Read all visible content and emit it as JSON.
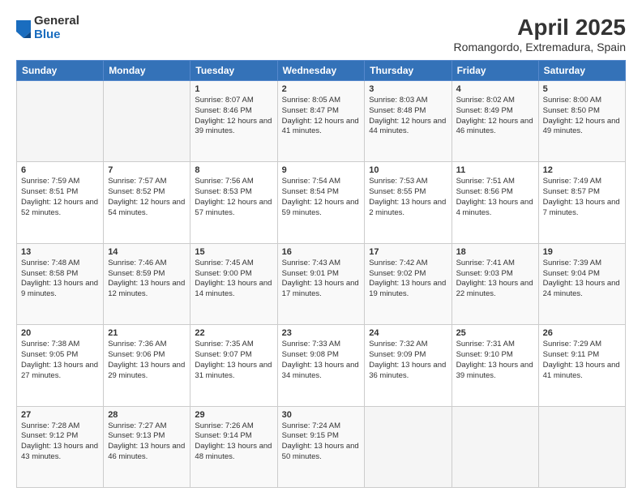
{
  "header": {
    "title": "April 2025",
    "subtitle": "Romangordo, Extremadura, Spain",
    "logo_general": "General",
    "logo_blue": "Blue"
  },
  "weekdays": [
    "Sunday",
    "Monday",
    "Tuesday",
    "Wednesday",
    "Thursday",
    "Friday",
    "Saturday"
  ],
  "weeks": [
    [
      {
        "day": "",
        "sunrise": "",
        "sunset": "",
        "daylight": ""
      },
      {
        "day": "",
        "sunrise": "",
        "sunset": "",
        "daylight": ""
      },
      {
        "day": "1",
        "sunrise": "Sunrise: 8:07 AM",
        "sunset": "Sunset: 8:46 PM",
        "daylight": "Daylight: 12 hours and 39 minutes."
      },
      {
        "day": "2",
        "sunrise": "Sunrise: 8:05 AM",
        "sunset": "Sunset: 8:47 PM",
        "daylight": "Daylight: 12 hours and 41 minutes."
      },
      {
        "day": "3",
        "sunrise": "Sunrise: 8:03 AM",
        "sunset": "Sunset: 8:48 PM",
        "daylight": "Daylight: 12 hours and 44 minutes."
      },
      {
        "day": "4",
        "sunrise": "Sunrise: 8:02 AM",
        "sunset": "Sunset: 8:49 PM",
        "daylight": "Daylight: 12 hours and 46 minutes."
      },
      {
        "day": "5",
        "sunrise": "Sunrise: 8:00 AM",
        "sunset": "Sunset: 8:50 PM",
        "daylight": "Daylight: 12 hours and 49 minutes."
      }
    ],
    [
      {
        "day": "6",
        "sunrise": "Sunrise: 7:59 AM",
        "sunset": "Sunset: 8:51 PM",
        "daylight": "Daylight: 12 hours and 52 minutes."
      },
      {
        "day": "7",
        "sunrise": "Sunrise: 7:57 AM",
        "sunset": "Sunset: 8:52 PM",
        "daylight": "Daylight: 12 hours and 54 minutes."
      },
      {
        "day": "8",
        "sunrise": "Sunrise: 7:56 AM",
        "sunset": "Sunset: 8:53 PM",
        "daylight": "Daylight: 12 hours and 57 minutes."
      },
      {
        "day": "9",
        "sunrise": "Sunrise: 7:54 AM",
        "sunset": "Sunset: 8:54 PM",
        "daylight": "Daylight: 12 hours and 59 minutes."
      },
      {
        "day": "10",
        "sunrise": "Sunrise: 7:53 AM",
        "sunset": "Sunset: 8:55 PM",
        "daylight": "Daylight: 13 hours and 2 minutes."
      },
      {
        "day": "11",
        "sunrise": "Sunrise: 7:51 AM",
        "sunset": "Sunset: 8:56 PM",
        "daylight": "Daylight: 13 hours and 4 minutes."
      },
      {
        "day": "12",
        "sunrise": "Sunrise: 7:49 AM",
        "sunset": "Sunset: 8:57 PM",
        "daylight": "Daylight: 13 hours and 7 minutes."
      }
    ],
    [
      {
        "day": "13",
        "sunrise": "Sunrise: 7:48 AM",
        "sunset": "Sunset: 8:58 PM",
        "daylight": "Daylight: 13 hours and 9 minutes."
      },
      {
        "day": "14",
        "sunrise": "Sunrise: 7:46 AM",
        "sunset": "Sunset: 8:59 PM",
        "daylight": "Daylight: 13 hours and 12 minutes."
      },
      {
        "day": "15",
        "sunrise": "Sunrise: 7:45 AM",
        "sunset": "Sunset: 9:00 PM",
        "daylight": "Daylight: 13 hours and 14 minutes."
      },
      {
        "day": "16",
        "sunrise": "Sunrise: 7:43 AM",
        "sunset": "Sunset: 9:01 PM",
        "daylight": "Daylight: 13 hours and 17 minutes."
      },
      {
        "day": "17",
        "sunrise": "Sunrise: 7:42 AM",
        "sunset": "Sunset: 9:02 PM",
        "daylight": "Daylight: 13 hours and 19 minutes."
      },
      {
        "day": "18",
        "sunrise": "Sunrise: 7:41 AM",
        "sunset": "Sunset: 9:03 PM",
        "daylight": "Daylight: 13 hours and 22 minutes."
      },
      {
        "day": "19",
        "sunrise": "Sunrise: 7:39 AM",
        "sunset": "Sunset: 9:04 PM",
        "daylight": "Daylight: 13 hours and 24 minutes."
      }
    ],
    [
      {
        "day": "20",
        "sunrise": "Sunrise: 7:38 AM",
        "sunset": "Sunset: 9:05 PM",
        "daylight": "Daylight: 13 hours and 27 minutes."
      },
      {
        "day": "21",
        "sunrise": "Sunrise: 7:36 AM",
        "sunset": "Sunset: 9:06 PM",
        "daylight": "Daylight: 13 hours and 29 minutes."
      },
      {
        "day": "22",
        "sunrise": "Sunrise: 7:35 AM",
        "sunset": "Sunset: 9:07 PM",
        "daylight": "Daylight: 13 hours and 31 minutes."
      },
      {
        "day": "23",
        "sunrise": "Sunrise: 7:33 AM",
        "sunset": "Sunset: 9:08 PM",
        "daylight": "Daylight: 13 hours and 34 minutes."
      },
      {
        "day": "24",
        "sunrise": "Sunrise: 7:32 AM",
        "sunset": "Sunset: 9:09 PM",
        "daylight": "Daylight: 13 hours and 36 minutes."
      },
      {
        "day": "25",
        "sunrise": "Sunrise: 7:31 AM",
        "sunset": "Sunset: 9:10 PM",
        "daylight": "Daylight: 13 hours and 39 minutes."
      },
      {
        "day": "26",
        "sunrise": "Sunrise: 7:29 AM",
        "sunset": "Sunset: 9:11 PM",
        "daylight": "Daylight: 13 hours and 41 minutes."
      }
    ],
    [
      {
        "day": "27",
        "sunrise": "Sunrise: 7:28 AM",
        "sunset": "Sunset: 9:12 PM",
        "daylight": "Daylight: 13 hours and 43 minutes."
      },
      {
        "day": "28",
        "sunrise": "Sunrise: 7:27 AM",
        "sunset": "Sunset: 9:13 PM",
        "daylight": "Daylight: 13 hours and 46 minutes."
      },
      {
        "day": "29",
        "sunrise": "Sunrise: 7:26 AM",
        "sunset": "Sunset: 9:14 PM",
        "daylight": "Daylight: 13 hours and 48 minutes."
      },
      {
        "day": "30",
        "sunrise": "Sunrise: 7:24 AM",
        "sunset": "Sunset: 9:15 PM",
        "daylight": "Daylight: 13 hours and 50 minutes."
      },
      {
        "day": "",
        "sunrise": "",
        "sunset": "",
        "daylight": ""
      },
      {
        "day": "",
        "sunrise": "",
        "sunset": "",
        "daylight": ""
      },
      {
        "day": "",
        "sunrise": "",
        "sunset": "",
        "daylight": ""
      }
    ]
  ]
}
